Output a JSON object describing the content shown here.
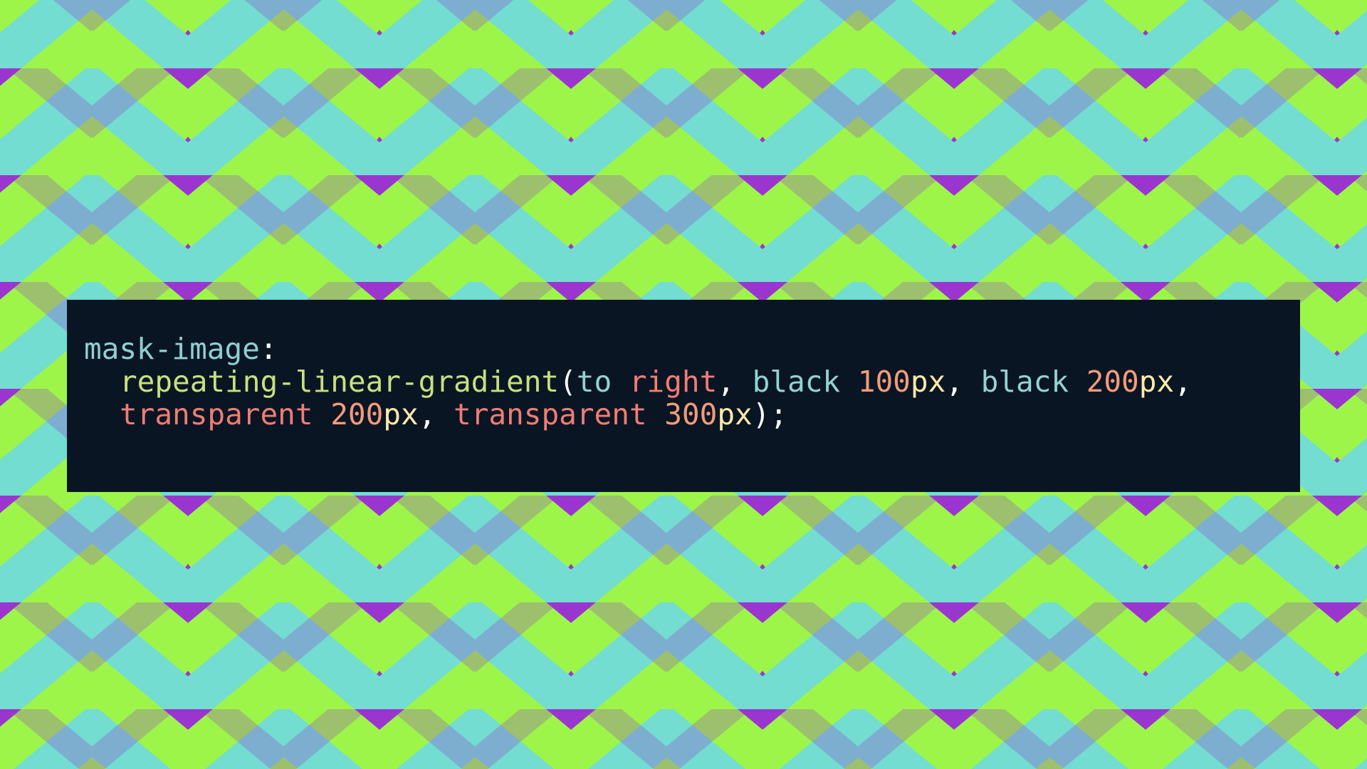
{
  "colors": {
    "background": "#9a36cf",
    "stripe_green": "#9ef54a",
    "stripe_teal": "#72ddd0",
    "stripe_purple": "#9a36cf",
    "panel": "#0a1524"
  },
  "code": {
    "line1": {
      "property": "mask-image",
      "colon": ":"
    },
    "line2": {
      "function": "repeating-linear-gradient",
      "paren_open": "(",
      "to": "to",
      "right": "right",
      "comma1": ",",
      "black1": "black",
      "num1": "100",
      "unit1": "px",
      "comma2": ",",
      "black2": "black",
      "num2": "200",
      "unit2": "px",
      "comma3": ","
    },
    "line3": {
      "transparent1": "transparent",
      "num3": "200",
      "unit3": "px",
      "comma4": ",",
      "transparent2": "transparent",
      "num4": "300",
      "unit4": "px",
      "close": ");"
    }
  }
}
